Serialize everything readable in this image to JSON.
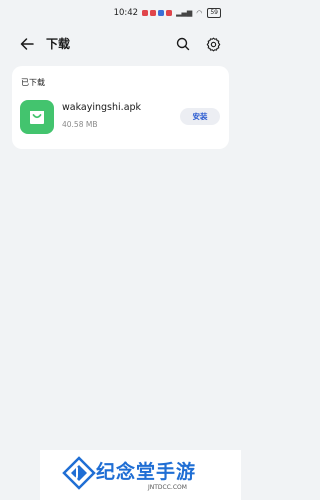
{
  "status_bar": {
    "time": "10:42",
    "battery": "59",
    "notification_colors": [
      "#e0454b",
      "#e0454b",
      "#3b6fd8",
      "#e0454b"
    ]
  },
  "header": {
    "title": "下载",
    "back_icon": "arrow-left-icon",
    "search_icon": "search-icon",
    "settings_icon": "gear-icon"
  },
  "section": {
    "title": "已下载",
    "items": [
      {
        "file_name": "wakayingshi.apk",
        "file_size": "40.58 MB",
        "action_label": "安装",
        "icon": "shopping-bag-icon",
        "icon_color": "#43c46e"
      }
    ]
  },
  "watermark": {
    "text": "纪念堂手游",
    "subtext": "JNTDCC.COM",
    "color": "#1f6ed4"
  }
}
